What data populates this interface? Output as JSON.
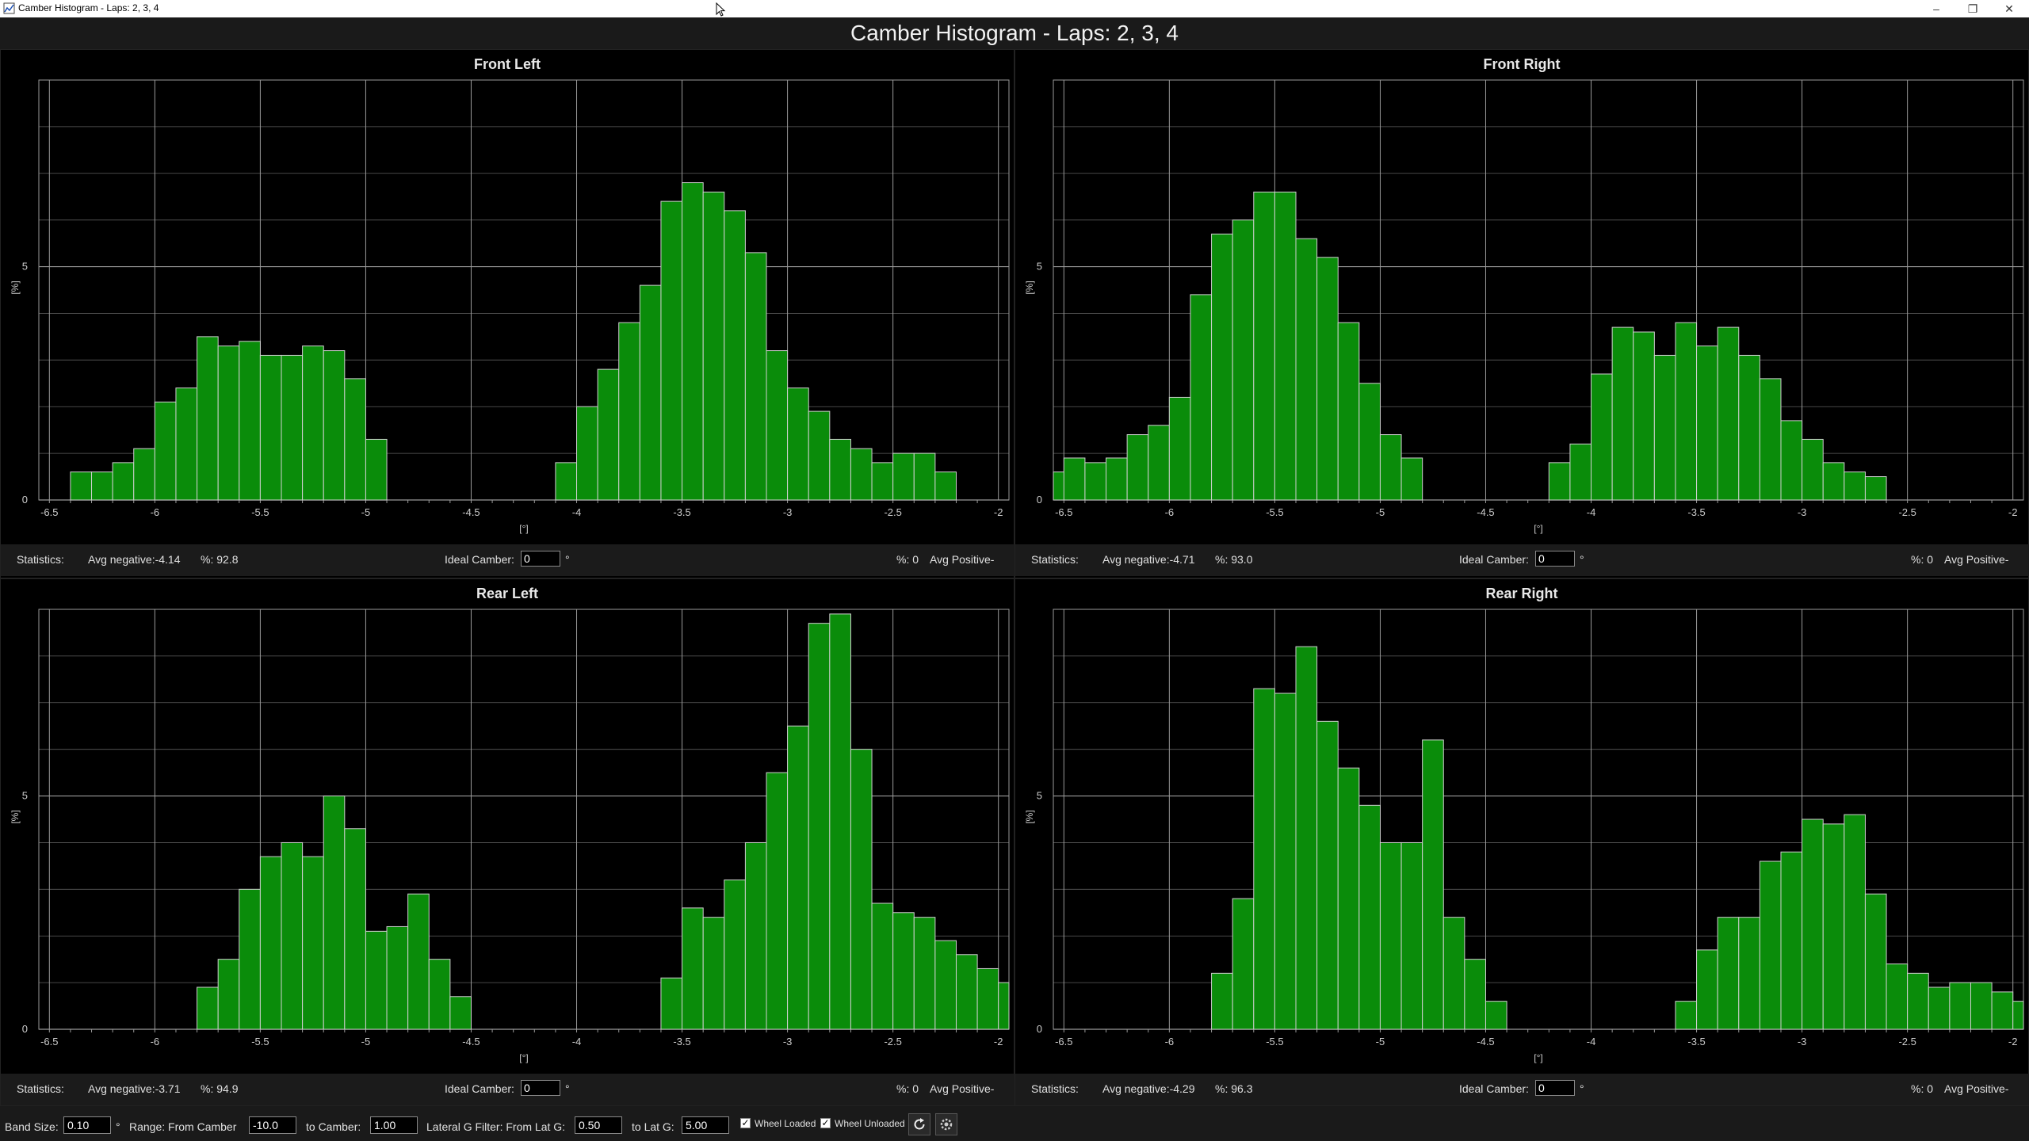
{
  "window": {
    "title": "Camber Histogram - Laps: 2, 3, 4",
    "min_glyph": "–",
    "max_glyph": "❐",
    "close_glyph": "✕"
  },
  "header": {
    "title": "Camber Histogram - Laps: 2, 3, 4"
  },
  "colors": {
    "bar_fill": "#0a8c0a",
    "bar_stroke": "#d0d0d0",
    "grid": "#9a9a9a",
    "background": "#000000",
    "stats_bg": "#1b1b1b"
  },
  "stats_labels": {
    "statistics": "Statistics:",
    "ideal_camber": "Ideal Camber:",
    "degree": "°",
    "percent_pos": "%: 0",
    "avg_positive": "Avg Positive-"
  },
  "panels": [
    {
      "key": "fl",
      "title": "Front Left",
      "avg_negative": "Avg negative:-4.14",
      "percent": "%: 92.8",
      "ideal_value": "0"
    },
    {
      "key": "fr",
      "title": "Front Right",
      "avg_negative": "Avg negative:-4.71",
      "percent": "%: 93.0",
      "ideal_value": "0"
    },
    {
      "key": "rl",
      "title": "Rear Left",
      "avg_negative": "Avg negative:-3.71",
      "percent": "%: 94.9",
      "ideal_value": "0"
    },
    {
      "key": "rr",
      "title": "Rear Right",
      "avg_negative": "Avg negative:-4.29",
      "percent": "%: 96.3",
      "ideal_value": "0"
    }
  ],
  "toolbar": {
    "band_size_label": "Band Size:",
    "band_size_value": "0.10",
    "band_unit": "°",
    "range_from_label": "Range: From Camber",
    "range_from_value": "-10.0",
    "to_camber_label": "to Camber:",
    "to_camber_value": "1.00",
    "lat_from_label": "Lateral G Filter: From Lat G:",
    "lat_from_value": "0.50",
    "to_lat_label": "to Lat G:",
    "to_lat_value": "5.00",
    "wheel_loaded_label": "Wheel Loaded",
    "wheel_loaded_checked": true,
    "wheel_unloaded_label": "Wheel Unloaded",
    "wheel_unloaded_checked": true,
    "refresh_icon": "refresh-icon",
    "settings_icon": "settings-icon"
  },
  "chart_data": [
    {
      "type": "bar",
      "title": "Front Left",
      "xlabel": "[°]",
      "ylabel": "[%]",
      "xlim": [
        -6.55,
        -1.95
      ],
      "ylim": [
        0,
        9
      ],
      "xticks": [
        -6.5,
        -6,
        -5.5,
        -5,
        -4.5,
        -4,
        -3.5,
        -3,
        -2.5,
        -2
      ],
      "yticks": [
        0,
        5
      ],
      "grid": true,
      "bin_width": 0.1,
      "bin_starts": [
        -6.4,
        -6.3,
        -6.2,
        -6.1,
        -6.0,
        -5.9,
        -5.8,
        -5.7,
        -5.6,
        -5.5,
        -5.4,
        -5.3,
        -5.2,
        -5.1,
        -5.0,
        -4.9,
        -4.8,
        -4.7,
        -4.6,
        -4.5,
        -4.4,
        -4.3,
        -4.2,
        -4.1,
        -4.0,
        -3.9,
        -3.8,
        -3.7,
        -3.6,
        -3.5,
        -3.4,
        -3.3,
        -3.2,
        -3.1,
        -3.0,
        -2.9,
        -2.8,
        -2.7,
        -2.6,
        -2.5,
        -2.4,
        -2.3
      ],
      "values": [
        0.6,
        0.6,
        0.8,
        1.1,
        2.1,
        2.4,
        3.5,
        3.3,
        3.4,
        3.1,
        3.1,
        3.3,
        3.2,
        2.6,
        1.3,
        0,
        0,
        0,
        0,
        0,
        0,
        0,
        0,
        0.8,
        2.0,
        2.8,
        3.8,
        4.6,
        6.4,
        6.8,
        6.6,
        6.2,
        5.3,
        3.2,
        2.4,
        1.9,
        1.3,
        1.1,
        0.8,
        1.0,
        1.0,
        0.6
      ]
    },
    {
      "type": "bar",
      "title": "Front Right",
      "xlabel": "[°]",
      "ylabel": "[%]",
      "xlim": [
        -6.55,
        -1.95
      ],
      "ylim": [
        0,
        9
      ],
      "xticks": [
        -6.5,
        -6,
        -5.5,
        -5,
        -4.5,
        -4,
        -3.5,
        -3,
        -2.5,
        -2
      ],
      "yticks": [
        0,
        5
      ],
      "grid": true,
      "bin_width": 0.1,
      "bin_starts": [
        -6.55,
        -6.5,
        -6.4,
        -6.3,
        -6.2,
        -6.1,
        -6.0,
        -5.9,
        -5.8,
        -5.7,
        -5.6,
        -5.5,
        -5.4,
        -5.3,
        -5.2,
        -5.1,
        -5.0,
        -4.9,
        -4.8,
        -4.7,
        -4.6,
        -4.5,
        -4.4,
        -4.3,
        -4.2,
        -4.1,
        -4.0,
        -3.9,
        -3.8,
        -3.7,
        -3.6,
        -3.5,
        -3.4,
        -3.3,
        -3.2,
        -3.1,
        -3.0,
        -2.9,
        -2.8,
        -2.7,
        -2.6,
        -2.5
      ],
      "values": [
        0.6,
        0.9,
        0.8,
        0.9,
        1.4,
        1.6,
        2.2,
        4.4,
        5.7,
        6.0,
        6.6,
        6.6,
        5.6,
        5.2,
        3.8,
        2.5,
        1.4,
        0.9,
        0,
        0,
        0,
        0,
        0,
        0,
        0.8,
        1.2,
        2.7,
        3.7,
        3.6,
        3.1,
        3.8,
        3.3,
        3.7,
        3.1,
        2.6,
        1.7,
        1.3,
        0.8,
        0.6,
        0.5,
        0,
        0
      ]
    },
    {
      "type": "bar",
      "title": "Rear Left",
      "xlabel": "[°]",
      "ylabel": "[%]",
      "xlim": [
        -6.55,
        -1.95
      ],
      "ylim": [
        0,
        9
      ],
      "xticks": [
        -6.5,
        -6,
        -5.5,
        -5,
        -4.5,
        -4,
        -3.5,
        -3,
        -2.5,
        -2
      ],
      "yticks": [
        0,
        5
      ],
      "grid": true,
      "bin_width": 0.1,
      "bin_starts": [
        -5.8,
        -5.7,
        -5.6,
        -5.5,
        -5.4,
        -5.3,
        -5.2,
        -5.1,
        -5.0,
        -4.9,
        -4.8,
        -4.7,
        -4.6,
        -4.5,
        -4.4,
        -4.3,
        -4.2,
        -4.1,
        -4.0,
        -3.9,
        -3.8,
        -3.7,
        -3.6,
        -3.5,
        -3.4,
        -3.3,
        -3.2,
        -3.1,
        -3.0,
        -2.9,
        -2.8,
        -2.7,
        -2.6,
        -2.5,
        -2.4,
        -2.3,
        -2.2,
        -2.1,
        -2.0
      ],
      "values": [
        0.9,
        1.5,
        3.0,
        3.7,
        4.0,
        3.7,
        5.0,
        4.3,
        2.1,
        2.2,
        2.9,
        1.5,
        0.7,
        0,
        0,
        0,
        0,
        0,
        0,
        0,
        0,
        0,
        1.1,
        2.6,
        2.4,
        3.2,
        4.0,
        5.5,
        6.5,
        8.7,
        8.9,
        6.0,
        2.7,
        2.5,
        2.4,
        1.9,
        1.6,
        1.3,
        1.0
      ]
    },
    {
      "type": "bar",
      "title": "Rear Right",
      "xlabel": "[°]",
      "ylabel": "[%]",
      "xlim": [
        -6.55,
        -1.95
      ],
      "ylim": [
        0,
        9
      ],
      "xticks": [
        -6.5,
        -6,
        -5.5,
        -5,
        -4.5,
        -4,
        -3.5,
        -3,
        -2.5,
        -2
      ],
      "yticks": [
        0,
        5
      ],
      "grid": true,
      "bin_width": 0.1,
      "bin_starts": [
        -5.8,
        -5.7,
        -5.6,
        -5.5,
        -5.4,
        -5.3,
        -5.2,
        -5.1,
        -5.0,
        -4.9,
        -4.8,
        -4.7,
        -4.6,
        -4.5,
        -4.4,
        -4.3,
        -4.2,
        -4.1,
        -4.0,
        -3.9,
        -3.8,
        -3.7,
        -3.6,
        -3.5,
        -3.4,
        -3.3,
        -3.2,
        -3.1,
        -3.0,
        -2.9,
        -2.8,
        -2.7,
        -2.6,
        -2.5,
        -2.4,
        -2.3,
        -2.2,
        -2.1,
        -2.0
      ],
      "values": [
        1.2,
        2.8,
        7.3,
        7.2,
        8.2,
        6.6,
        5.6,
        4.8,
        4.0,
        4.0,
        6.2,
        2.4,
        1.5,
        0.6,
        0,
        0,
        0,
        0,
        0,
        0,
        0,
        0,
        0.6,
        1.7,
        2.4,
        2.4,
        3.6,
        3.8,
        4.5,
        4.4,
        4.6,
        2.9,
        1.4,
        1.2,
        0.9,
        1.0,
        1.0,
        0.8,
        0.6
      ]
    }
  ]
}
